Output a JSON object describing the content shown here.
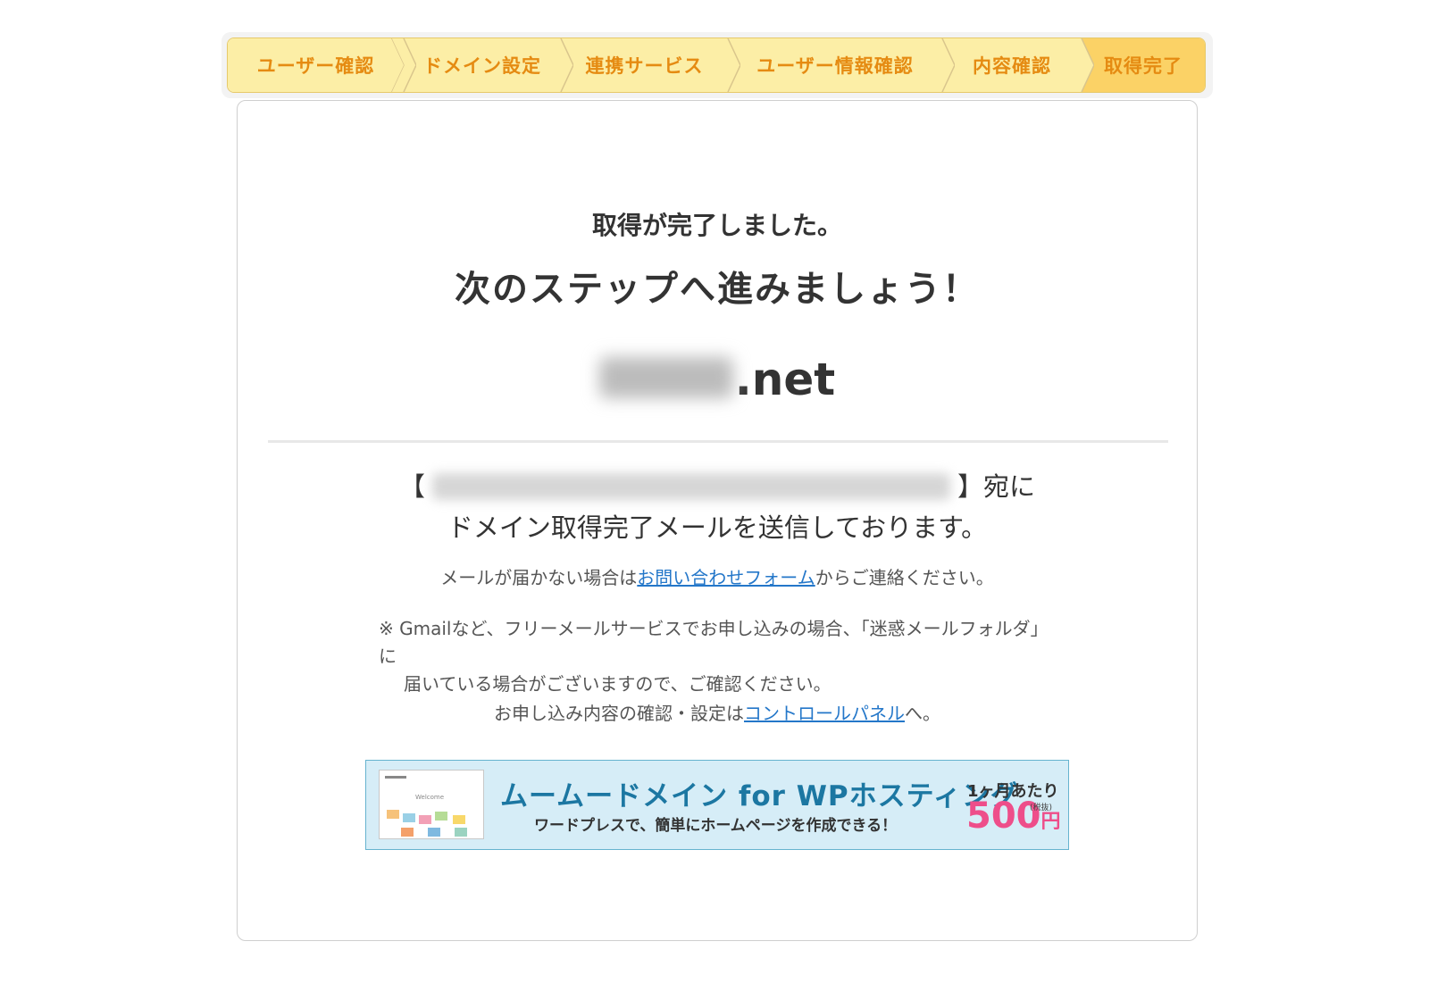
{
  "steps": [
    {
      "label": "ユーザー確認",
      "active": false
    },
    {
      "label": "ドメイン設定",
      "active": false
    },
    {
      "label": "連携サービス",
      "active": false
    },
    {
      "label": "ユーザー情報確認",
      "active": false
    },
    {
      "label": "内容確認",
      "active": false
    },
    {
      "label": "取得完了",
      "active": true
    }
  ],
  "main": {
    "done_message": "取得が完了しました。",
    "next_message": "次のステップへ進みましょう！",
    "domain_suffix": ".net",
    "mail_open_bracket": "【",
    "mail_close_suffix": "】宛に",
    "mail_sent_line": "ドメイン取得完了メールを送信しております。",
    "contact_prefix": "メールが届かない場合は",
    "contact_link": "お問い合わせフォーム",
    "contact_suffix": "からご連絡ください。",
    "note_line1": "※ Gmailなど、フリーメールサービスでお申し込みの場合、「迷惑メールフォルダ」に",
    "note_line2": "届いている場合がございますので、ご確認ください。",
    "cp_prefix": "お申し込み内容の確認・設定は",
    "cp_link": "コントロールパネル",
    "cp_suffix": "へ。"
  },
  "banner": {
    "title": "ムームードメイン for WPホスティング",
    "subtitle": "ワードプレスで、簡単にホームページを作成できる！",
    "per_month": "1ヶ月あたり",
    "price": "500",
    "currency": "円",
    "tax_note": "(税抜)",
    "screenshot_text": "Welcome"
  },
  "colors": {
    "step_bg": "#fceea6",
    "step_active_bg": "#fbd266",
    "step_text": "#e58b12",
    "link": "#2477c9",
    "banner_bg": "#d6edf7",
    "banner_title": "#1c77a2",
    "price": "#ee4e8a"
  }
}
